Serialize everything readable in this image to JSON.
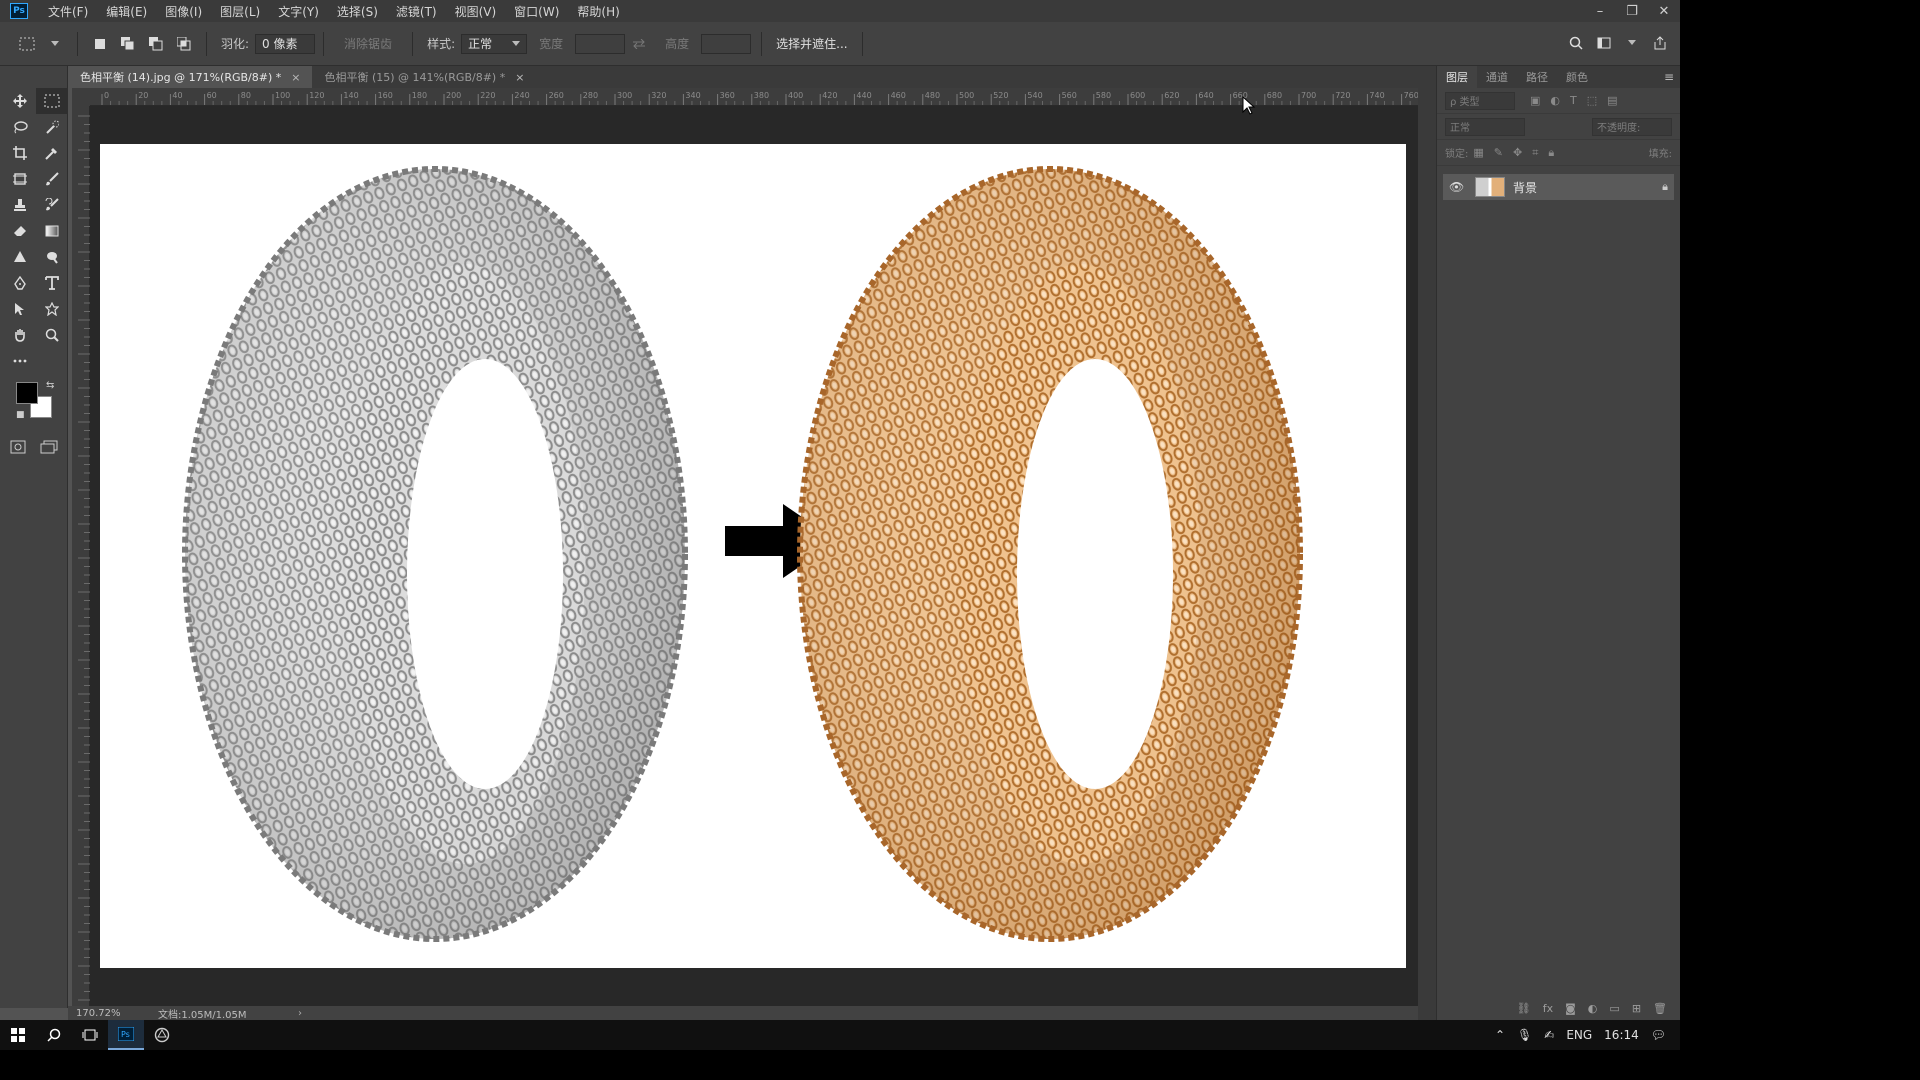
{
  "menubar": {
    "logo": "Ps",
    "items": [
      "文件(F)",
      "编辑(E)",
      "图像(I)",
      "图层(L)",
      "文字(Y)",
      "选择(S)",
      "滤镜(T)",
      "视图(V)",
      "窗口(W)",
      "帮助(H)"
    ],
    "window_controls": [
      "–",
      "❐",
      "✕"
    ]
  },
  "options": {
    "feather_label": "羽化:",
    "feather_value": "0 像素",
    "antialias_label": "消除锯齿",
    "style_label": "样式:",
    "style_value": "正常",
    "width_label": "宽度",
    "height_label": "高度",
    "select_mask_button": "选择并遮住..."
  },
  "tabs": [
    {
      "label": "色相平衡 (14).jpg @ 171%(RGB/8#) *",
      "close": "×"
    },
    {
      "label": "色相平衡 (15) @ 141%(RGB/8#) *",
      "close": "×"
    }
  ],
  "ruler_labels": [
    "0",
    "20",
    "40",
    "60",
    "80",
    "100",
    "120",
    "140",
    "160",
    "180",
    "200",
    "220",
    "240",
    "260",
    "280",
    "300",
    "320",
    "340",
    "360",
    "380",
    "400",
    "420",
    "440",
    "460",
    "480",
    "500",
    "520",
    "540",
    "560",
    "580",
    "600",
    "620",
    "640",
    "660",
    "680",
    "700",
    "720",
    "740",
    "760"
  ],
  "status": {
    "zoom": "170.72%",
    "doc": "文档:1.05M/1.05M",
    "more": "›"
  },
  "panel": {
    "tabs": [
      "图层",
      "通道",
      "路径",
      "颜色"
    ],
    "menu": "≡",
    "filter_label": "ρ 类型",
    "blend_mode": "正常",
    "opacity_label": "不透明度:",
    "lock_label": "锁定:",
    "fill_label": "填充:",
    "layer_name": "背景"
  },
  "taskbar": {
    "language": "ENG",
    "time": "16:14"
  },
  "colors": {
    "foreground": "#000000",
    "background": "#ffffff",
    "silver": "#c8c8c8",
    "gold": "#e0a86a"
  },
  "icons": {
    "tools": [
      "move-icon",
      "marquee-icon",
      "lasso-icon",
      "quick-select-icon",
      "crop-icon",
      "eyedropper-icon",
      "frame-icon",
      "brush-icon",
      "stamp-icon",
      "history-brush-icon",
      "eraser-icon",
      "gradient-icon",
      "sharpen-icon",
      "dodge-icon",
      "pen-icon",
      "type-icon",
      "path-select-icon",
      "shape-icon",
      "hand-icon",
      "zoom-icon"
    ]
  }
}
